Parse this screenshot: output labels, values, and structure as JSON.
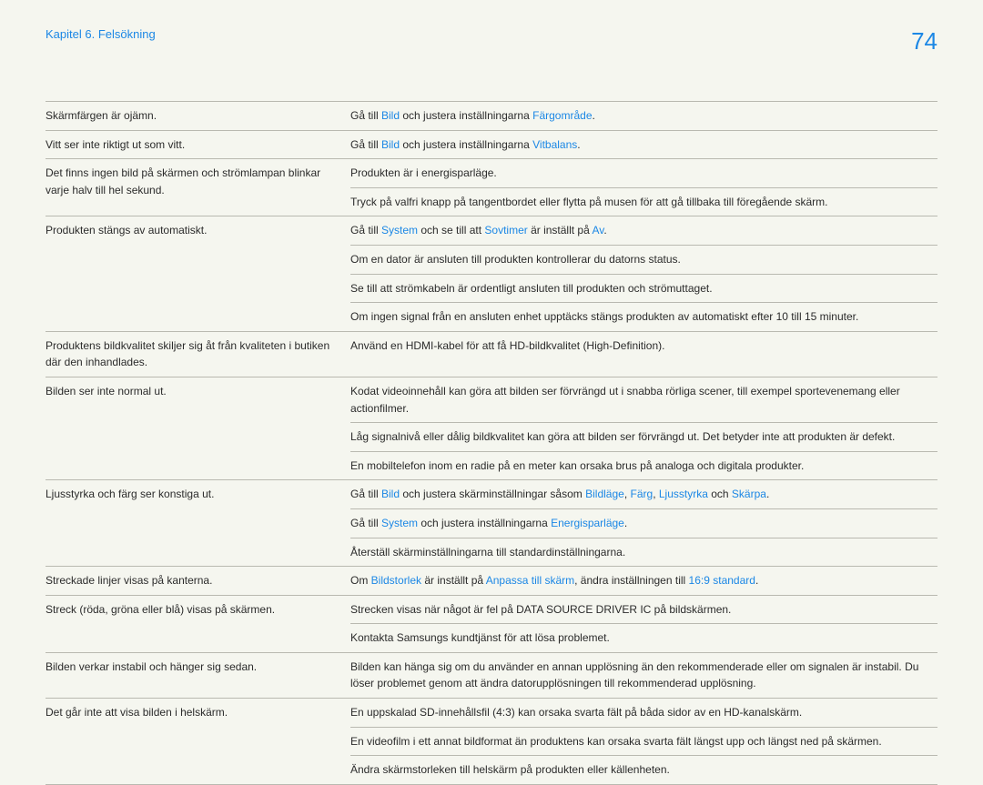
{
  "header": {
    "chapter": "Kapitel 6. Felsökning",
    "page": "74"
  },
  "rows": [
    {
      "left": "Skärmfärgen är ojämn.",
      "right": [
        {
          "t": "Gå till "
        },
        {
          "t": "Bild",
          "link": true
        },
        {
          "t": " och justera inställningarna "
        },
        {
          "t": "Färgområde",
          "link": true
        },
        {
          "t": "."
        }
      ]
    },
    {
      "left": "Vitt ser inte riktigt ut som vitt.",
      "right": [
        {
          "t": "Gå till "
        },
        {
          "t": "Bild",
          "link": true
        },
        {
          "t": " och justera inställningarna "
        },
        {
          "t": "Vitbalans",
          "link": true
        },
        {
          "t": "."
        }
      ]
    },
    {
      "left": "Det finns ingen bild på skärmen och strömlampan blinkar varje halv till hel sekund.",
      "right": [
        {
          "t": "Produkten är i energisparläge."
        }
      ],
      "leftRowspan": 2
    },
    {
      "right": [
        {
          "t": "Tryck på valfri knapp på tangentbordet eller flytta på musen för att gå tillbaka till föregående skärm."
        }
      ]
    },
    {
      "left": "Produkten stängs av automatiskt.",
      "right": [
        {
          "t": "Gå till "
        },
        {
          "t": "System",
          "link": true
        },
        {
          "t": " och se till att "
        },
        {
          "t": "Sovtimer",
          "link": true
        },
        {
          "t": " är inställt på "
        },
        {
          "t": "Av",
          "link": true
        },
        {
          "t": "."
        }
      ],
      "leftRowspan": 4
    },
    {
      "right": [
        {
          "t": "Om en dator är ansluten till produkten kontrollerar du datorns status."
        }
      ]
    },
    {
      "right": [
        {
          "t": "Se till att strömkabeln är ordentligt ansluten till produkten och strömuttaget."
        }
      ]
    },
    {
      "right": [
        {
          "t": "Om ingen signal från en ansluten enhet upptäcks stängs produkten av automatiskt efter 10 till 15 minuter."
        }
      ]
    },
    {
      "left": "Produktens bildkvalitet skiljer sig åt från kvaliteten i butiken där den inhandlades.",
      "right": [
        {
          "t": "Använd en HDMI-kabel för att få HD-bildkvalitet (High-Definition)."
        }
      ]
    },
    {
      "left": "Bilden ser inte normal ut.",
      "right": [
        {
          "t": "Kodat videoinnehåll kan göra att bilden ser förvrängd ut i snabba rörliga scener, till exempel sportevenemang eller actionfilmer."
        }
      ],
      "leftRowspan": 3
    },
    {
      "right": [
        {
          "t": "Låg signalnivå eller dålig bildkvalitet kan göra att bilden ser förvrängd ut. Det betyder inte att produkten är defekt."
        }
      ]
    },
    {
      "right": [
        {
          "t": "En mobiltelefon inom en radie på en meter kan orsaka brus på analoga och digitala produkter."
        }
      ]
    },
    {
      "left": "Ljusstyrka och färg ser konstiga ut.",
      "right": [
        {
          "t": "Gå till "
        },
        {
          "t": "Bild",
          "link": true
        },
        {
          "t": " och justera skärminställningar såsom "
        },
        {
          "t": "Bildläge",
          "link": true
        },
        {
          "t": ", "
        },
        {
          "t": "Färg",
          "link": true
        },
        {
          "t": ", "
        },
        {
          "t": "Ljusstyrka",
          "link": true
        },
        {
          "t": " och "
        },
        {
          "t": "Skärpa",
          "link": true
        },
        {
          "t": "."
        }
      ],
      "leftRowspan": 3
    },
    {
      "right": [
        {
          "t": "Gå till "
        },
        {
          "t": "System",
          "link": true
        },
        {
          "t": " och justera inställningarna "
        },
        {
          "t": "Energisparläge",
          "link": true
        },
        {
          "t": "."
        }
      ]
    },
    {
      "right": [
        {
          "t": "Återställ skärminställningarna till standardinställningarna."
        }
      ]
    },
    {
      "left": "Streckade linjer visas på kanterna.",
      "right": [
        {
          "t": "Om "
        },
        {
          "t": "Bildstorlek",
          "link": true
        },
        {
          "t": " är inställt på "
        },
        {
          "t": "Anpassa till skärm",
          "link": true
        },
        {
          "t": ", ändra inställningen till "
        },
        {
          "t": "16:9 standard",
          "link": true
        },
        {
          "t": "."
        }
      ]
    },
    {
      "left": "Streck (röda, gröna eller blå) visas på skärmen.",
      "right": [
        {
          "t": "Strecken visas när något är fel på DATA SOURCE DRIVER IC på bildskärmen."
        }
      ],
      "leftRowspan": 2
    },
    {
      "right": [
        {
          "t": "Kontakta Samsungs kundtjänst för att lösa problemet."
        }
      ]
    },
    {
      "left": "Bilden verkar instabil och hänger sig sedan.",
      "right": [
        {
          "t": "Bilden kan hänga sig om du använder en annan upplösning än den rekommenderade eller om signalen är instabil. Du löser problemet genom att ändra datorupplösningen till rekommenderad upplösning."
        }
      ]
    },
    {
      "left": "Det går inte att visa bilden i helskärm.",
      "right": [
        {
          "t": "En uppskalad SD-innehållsfil (4:3) kan orsaka svarta fält på båda sidor av en HD-kanalskärm."
        }
      ],
      "leftRowspan": 3
    },
    {
      "right": [
        {
          "t": "En videofilm i ett annat bildformat än produktens kan orsaka svarta fält längst upp och längst ned på skärmen."
        }
      ]
    },
    {
      "right": [
        {
          "t": "Ändra skärmstorleken till helskärm på produkten eller källenheten."
        }
      ]
    }
  ]
}
